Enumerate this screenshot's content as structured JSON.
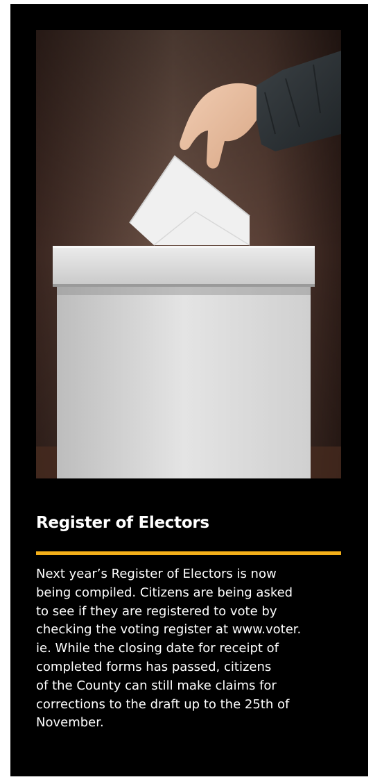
{
  "article": {
    "image_alt": "Hand placing a ballot envelope into a white ballot box",
    "title": "Register of Electors",
    "body": "Next year’s Register of Electors is now\nbeing compiled.  Citizens are being asked\nto see if they are registered to vote by\nchecking the voting register at www.voter.\nie.  While the closing date for receipt of\ncompleted forms has passed, citizens\nof the County can still make claims for\ncorrections to the draft up to the 25th of\nNovember."
  },
  "colors": {
    "card_background": "#000000",
    "accent_divider": "#f4b01a",
    "text": "#ffffff"
  }
}
